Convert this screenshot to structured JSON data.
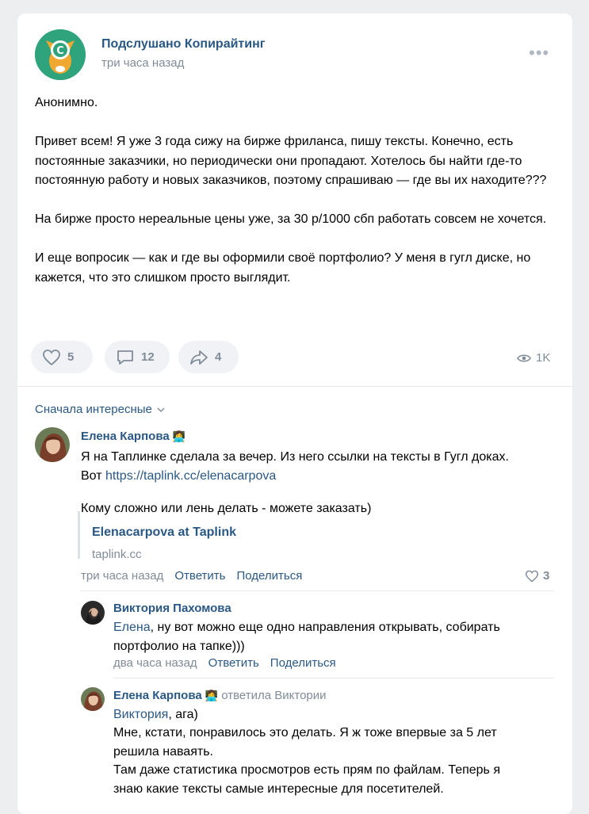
{
  "post": {
    "group_name": "Подслушано Копирайтинг",
    "time": "три часа назад",
    "more_icon": "•••",
    "text": "Анонимно.\n\nПривет всем! Я уже 3 года сижу на бирже фриланса, пишу тексты. Конечно, есть постоянные заказчики, но периодически они пропадают. Хотелось бы найти где-то постоянную работу и новых заказчиков, поэтому спрашиваю — где вы их находите???\n\nНа бирже просто нереальные цены уже, за 30 р/1000 сбп работать совсем не хочется.\n\nИ еще вопросик — как и где вы оформили своё портфолио? У меня в гугл диске, но кажется, что это слишком просто выглядит.",
    "likes": "5",
    "comments": "12",
    "shares": "4",
    "views": "1K"
  },
  "comments": {
    "sort_label": "Сначала интересные",
    "c1": {
      "name": "Елена Карпова",
      "badge": "👩‍💻",
      "text_before_link": "Я на Таплинке сделала за вечер. Из него ссылки на тексты в Гугл доках.\nВот ",
      "link": "https://taplink.cc/elenacarpova",
      "text_after": "Кому сложно или лень делать - можете заказать)",
      "snippet_title": "Elenacarpova at Taplink",
      "snippet_url": "taplink.cc",
      "time": "три часа назад",
      "reply": "Ответить",
      "share": "Поделиться",
      "likes": "3"
    },
    "c2": {
      "name": "Виктория Пахомова",
      "mention": "Елена",
      "text": ", ну вот можно еще одно направления открывать, собирать\nпортфолио на тапке)))",
      "time": "два часа назад",
      "reply": "Ответить",
      "share": "Поделиться"
    },
    "c3": {
      "name": "Елена Карпова",
      "badge": "👩‍💻",
      "replied_to": "ответила Виктории",
      "mention": "Виктория",
      "text_first": ", ага)",
      "text": "Мне, кстати, понравилось это делать. Я ж тоже впервые за 5 лет\nрешила наваять.\nТам даже статистика просмотров есть прям по файлам. Теперь я\nзнаю какие тексты самые интересные для посетителей."
    }
  },
  "colors": {
    "accent": "#2a5885",
    "muted": "#818c99",
    "bg": "#edeef0"
  }
}
